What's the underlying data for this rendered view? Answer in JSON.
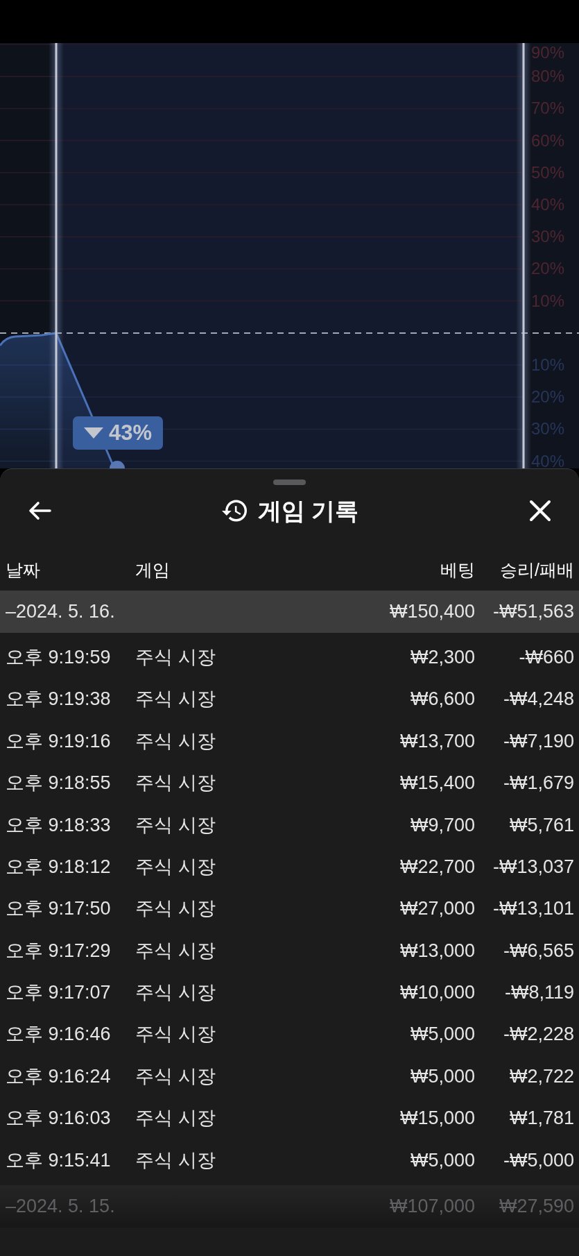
{
  "chart": {
    "upper_scale": [
      "90%",
      "80%",
      "70%",
      "60%",
      "50%",
      "40%",
      "30%",
      "20%",
      "10%"
    ],
    "lower_scale": [
      "10%",
      "20%",
      "30%",
      "40%"
    ],
    "badge": "43%"
  },
  "sheet": {
    "title": "게임 기록",
    "columns": [
      "날짜",
      "게임",
      "베팅",
      "승리/패배"
    ],
    "groups": [
      {
        "date": "–2024. 5. 16.",
        "bet": "₩150,400",
        "result": "-₩51,563",
        "rows": [
          {
            "time": "오후 9:19:59",
            "game": "주식 시장",
            "bet": "₩2,300",
            "result": "-₩660"
          },
          {
            "time": "오후 9:19:38",
            "game": "주식 시장",
            "bet": "₩6,600",
            "result": "-₩4,248"
          },
          {
            "time": "오후 9:19:16",
            "game": "주식 시장",
            "bet": "₩13,700",
            "result": "-₩7,190"
          },
          {
            "time": "오후 9:18:55",
            "game": "주식 시장",
            "bet": "₩15,400",
            "result": "-₩1,679"
          },
          {
            "time": "오후 9:18:33",
            "game": "주식 시장",
            "bet": "₩9,700",
            "result": "₩5,761"
          },
          {
            "time": "오후 9:18:12",
            "game": "주식 시장",
            "bet": "₩22,700",
            "result": "-₩13,037"
          },
          {
            "time": "오후 9:17:50",
            "game": "주식 시장",
            "bet": "₩27,000",
            "result": "-₩13,101"
          },
          {
            "time": "오후 9:17:29",
            "game": "주식 시장",
            "bet": "₩13,000",
            "result": "-₩6,565"
          },
          {
            "time": "오후 9:17:07",
            "game": "주식 시장",
            "bet": "₩10,000",
            "result": "-₩8,119"
          },
          {
            "time": "오후 9:16:46",
            "game": "주식 시장",
            "bet": "₩5,000",
            "result": "-₩2,228"
          },
          {
            "time": "오후 9:16:24",
            "game": "주식 시장",
            "bet": "₩5,000",
            "result": "₩2,722"
          },
          {
            "time": "오후 9:16:03",
            "game": "주식 시장",
            "bet": "₩15,000",
            "result": "₩1,781"
          },
          {
            "time": "오후 9:15:41",
            "game": "주식 시장",
            "bet": "₩5,000",
            "result": "-₩5,000"
          }
        ]
      },
      {
        "date": "–2024. 5. 15.",
        "bet": "₩107,000",
        "result": "₩27,590"
      }
    ]
  }
}
